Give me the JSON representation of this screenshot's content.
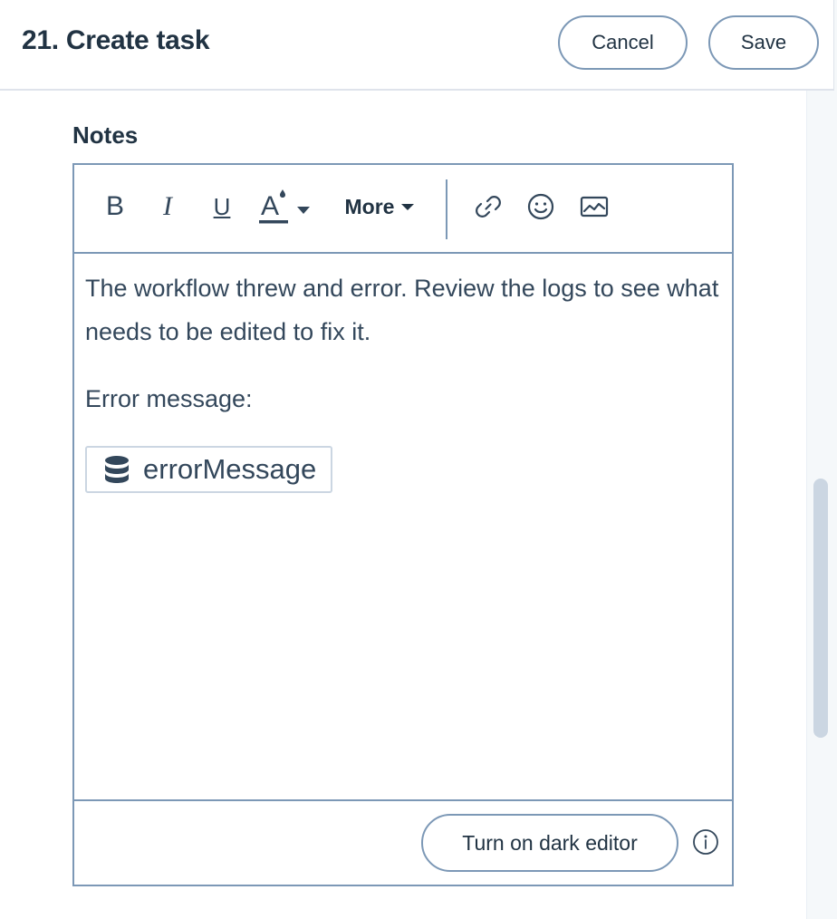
{
  "header": {
    "title": "21. Create task",
    "cancel_label": "Cancel",
    "save_label": "Save"
  },
  "notes": {
    "label": "Notes",
    "toolbar": {
      "bold_label": "B",
      "italic_label": "I",
      "underline_label": "U",
      "text_color_label": "A",
      "more_label": "More",
      "icons": [
        "bold-icon",
        "italic-icon",
        "underline-icon",
        "text-color-icon",
        "link-icon",
        "emoji-icon",
        "image-icon"
      ]
    },
    "body": {
      "paragraph1": "The workflow threw and error. Review the logs to see what needs to be edited to fix it.",
      "paragraph2": "Error message:",
      "token": "errorMessage",
      "token_icon": "database-icon"
    },
    "footer": {
      "dark_editor_label": "Turn on dark editor",
      "info_icon": "info-icon"
    }
  },
  "colors": {
    "border": "#7c98b6",
    "text": "#33475b",
    "heading": "#213343"
  }
}
